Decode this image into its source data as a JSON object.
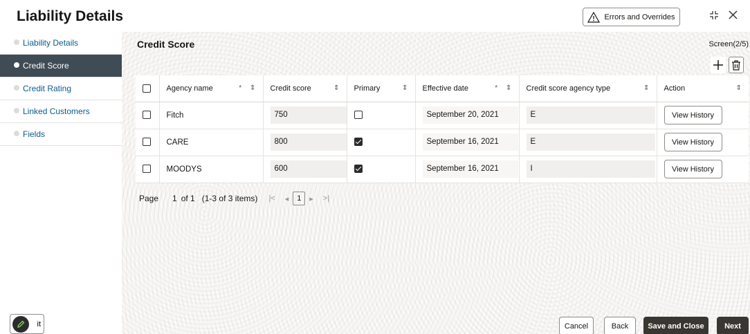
{
  "header": {
    "title": "Liability Details",
    "errors_button": "Errors and Overrides"
  },
  "sidebar": {
    "items": [
      {
        "label": "Liability Details",
        "active": false
      },
      {
        "label": "Credit Score",
        "active": true
      },
      {
        "label": "Credit Rating",
        "active": false
      },
      {
        "label": "Linked Customers",
        "active": false
      },
      {
        "label": "Fields",
        "active": false
      }
    ]
  },
  "main": {
    "section_title": "Credit Score",
    "screen_indicator": "Screen(2/5)",
    "table": {
      "columns": [
        {
          "label": "Agency name",
          "required": true,
          "sortable": true
        },
        {
          "label": "Credit score",
          "required": false,
          "sortable": true
        },
        {
          "label": "Primary",
          "required": false,
          "sortable": true
        },
        {
          "label": "Effective date",
          "required": true,
          "sortable": true
        },
        {
          "label": "Credit score agency type",
          "required": false,
          "sortable": true
        },
        {
          "label": "Action",
          "required": false,
          "sortable": true
        }
      ],
      "rows": [
        {
          "agency": "Fitch",
          "score": "750",
          "primary": false,
          "date": "September 20, 2021",
          "type": "E",
          "action": "View History"
        },
        {
          "agency": "CARE",
          "score": "800",
          "primary": true,
          "date": "September 16, 2021",
          "type": "E",
          "action": "View History"
        },
        {
          "agency": "MOODYS",
          "score": "600",
          "primary": true,
          "date": "September 16, 2021",
          "type": "I",
          "action": "View History"
        }
      ]
    },
    "pagination": {
      "page_label": "Page",
      "current": "1",
      "of_label": "of 1",
      "items_label": "(1-3 of 3 items)",
      "page_box": "1"
    }
  },
  "footer": {
    "audit_label": "it",
    "cancel": "Cancel",
    "back": "Back",
    "save_close": "Save and Close",
    "next": "Next"
  }
}
